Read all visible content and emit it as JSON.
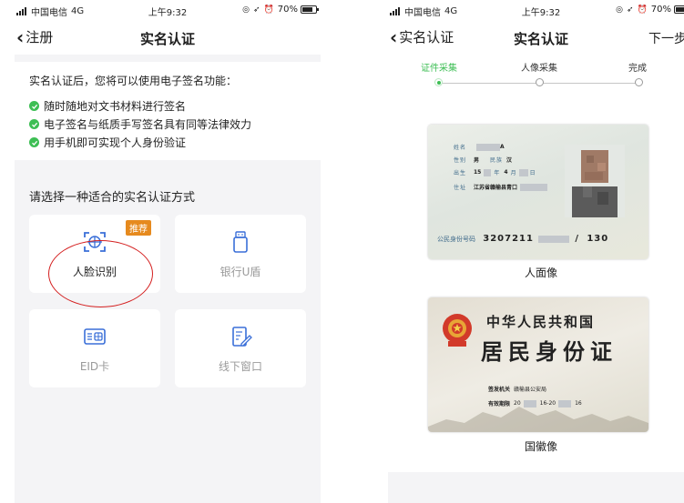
{
  "left": {
    "status": {
      "carrier": "中国电信",
      "network": "4G",
      "time": "上午9:32",
      "battery": "70%"
    },
    "nav": {
      "back": "注册",
      "title": "实名认证"
    },
    "intro": {
      "lead": "实名认证后，您将可以使用电子签名功能：",
      "benefits": [
        "随时随地对文书材料进行签名",
        "电子签名与纸质手写签名具有同等法律效力",
        "用手机即可实现个人身份验证"
      ]
    },
    "methods": {
      "title": "请选择一种适合的实名认证方式",
      "face": {
        "label": "人脸识别",
        "badge": "推荐"
      },
      "ukey": {
        "label": "银行U盾"
      },
      "eid": {
        "label": "EID卡"
      },
      "offline": {
        "label": "线下窗口"
      }
    },
    "colors": {
      "accent_green": "#3dbe54",
      "badge_orange": "#e68a1e",
      "highlight_red": "#d42020"
    }
  },
  "right": {
    "status": {
      "carrier": "中国电信",
      "network": "4G",
      "time": "上午9:32",
      "battery": "70%"
    },
    "nav": {
      "back": "实名认证",
      "title": "实名认证",
      "next": "下一步"
    },
    "steps": [
      {
        "label": "证件采集",
        "active": true
      },
      {
        "label": "人像采集",
        "active": false
      },
      {
        "label": "完成",
        "active": false
      }
    ],
    "front": {
      "caption": "人面像",
      "fields": {
        "name_label": "姓名",
        "name_value": "A",
        "gender_label": "性别",
        "gender_value": "男",
        "ethnic_label": "民族",
        "ethnic_value": "汉",
        "birth_label": "出生",
        "birth_year": "15",
        "birth_year_unit": "年",
        "birth_month": "4",
        "birth_month_unit": "月",
        "birth_day_unit": "日",
        "address_label": "住址",
        "address_value": "江苏省赣榆县青口",
        "id_label": "公民身份号码",
        "id_value_start": "3207211",
        "id_value_end": "130"
      }
    },
    "back": {
      "caption": "国徽像",
      "title1": "中华人民共和国",
      "title2": "居民身份证",
      "authority_label": "签发机关",
      "authority_value": "赣榆县公安局",
      "valid_label": "有效期限",
      "valid_value_1": "20",
      "valid_value_2": "16-20",
      "valid_value_3": "16"
    }
  }
}
